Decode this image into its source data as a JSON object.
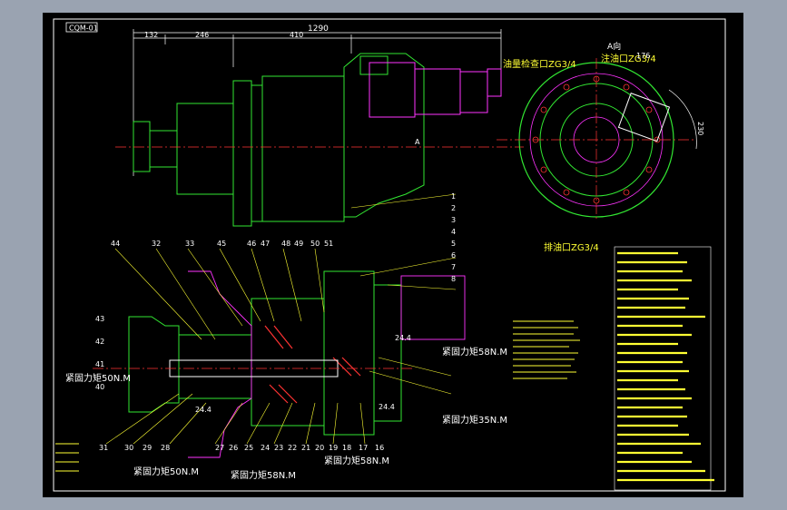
{
  "drawing": {
    "code": "CQM-01",
    "dims": {
      "total": "1290",
      "d1": "132",
      "d2": "246",
      "d3": "410",
      "d4": "176",
      "d5": "230",
      "section": "A",
      "section_arrow": "A向"
    },
    "ports": {
      "oil_check": "油量检查口ZG3/4",
      "fill": "注油口ZG3/4",
      "drain": "排油口ZG3/4"
    },
    "torques": {
      "t1": "紧固力矩58N.M",
      "t2": "紧固力矩50N.M",
      "t3": "紧固力矩35N.M",
      "t4": "紧固力矩50N.M",
      "t5": "紧固力矩58N.M",
      "t6": "紧固力矩58N.M"
    },
    "small": {
      "s1": "24.4",
      "s2": "24.4",
      "s3": "24.4"
    },
    "balloons_top": [
      "44",
      "32",
      "33",
      "45",
      "46",
      "47",
      "48",
      "49",
      "50",
      "51"
    ],
    "balloons_bottom": [
      "31",
      "30",
      "29",
      "28",
      "27",
      "26",
      "25",
      "24",
      "23",
      "22",
      "21",
      "20",
      "19",
      "18",
      "17",
      "16"
    ],
    "balloons_right": [
      "1",
      "2",
      "3",
      "4",
      "5",
      "6",
      "7",
      "8"
    ],
    "balloons_left": [
      "43",
      "42",
      "41",
      "40"
    ]
  }
}
